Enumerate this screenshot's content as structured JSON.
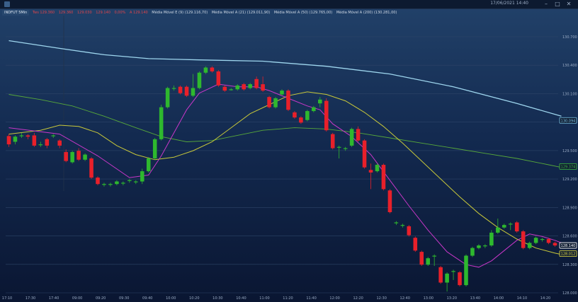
{
  "window": {
    "datetime": "17/06/2021 14:40",
    "buttons": [
      "–",
      "□",
      "✕"
    ]
  },
  "legend": {
    "symbol": "INDFUT 5Min",
    "quote": [
      {
        "text": "Tws 129.360"
      },
      {
        "text": "129.360"
      },
      {
        "text": "129.030"
      },
      {
        "text": "129.140"
      },
      {
        "text": "0,00%"
      },
      {
        "text": "A 129.140"
      }
    ],
    "indicators": [
      {
        "text": "Média Móvel E (9) (129.116,70)"
      },
      {
        "text": "Média Móvel A (21) (129.011,90)"
      },
      {
        "text": "Média Móvel A (50) (129.765,00)"
      },
      {
        "text": "Média Móvel A (200) (130.281,00)"
      }
    ]
  },
  "colors": {
    "up": "#2eb82e",
    "down": "#e8202a",
    "ema9": "#c837c8",
    "sma21": "#c8c83a",
    "sma50": "#57a83a",
    "sma200": "#9ed6ee",
    "grid": "#2c4468",
    "crosshair": "#22324a"
  },
  "chart_data": {
    "type": "candlestick",
    "y_axis_ticks": [
      "130.700",
      "130.400",
      "130.100",
      "129.800",
      "129.500",
      "129.200",
      "128.900",
      "128.600",
      "128.300",
      "128.000"
    ],
    "x_axis_ticks": [
      "17:10",
      "17:30",
      "17:40",
      "09:00",
      "09:20",
      "09:30",
      "09:40",
      "10:00",
      "10:20",
      "10:30",
      "10:40",
      "11:00",
      "11:20",
      "11:40",
      "12:00",
      "12:20",
      "12:30",
      "12:40",
      "13:00",
      "13:20",
      "13:40",
      "14:00",
      "14:10",
      "14:20"
    ],
    "price_tags": [
      {
        "label": "130.094",
        "value": 130.094,
        "color": "#7ec8e8"
      },
      {
        "label": "129.374",
        "value": 129.374,
        "color": "#3fbf3f"
      },
      {
        "label": "128.140",
        "value": 128.14,
        "color": "#ffffff"
      },
      {
        "label": "128.012",
        "value": 128.012,
        "color": "#e8e040"
      }
    ],
    "candles": [
      {
        "o": 129.85,
        "c": 129.72,
        "h": 129.88,
        "l": 129.68
      },
      {
        "o": 129.76,
        "c": 129.84,
        "h": 129.86,
        "l": 129.72
      },
      {
        "o": 129.86,
        "c": 129.86,
        "h": 129.9,
        "l": 129.82
      },
      {
        "o": 129.86,
        "c": 129.84,
        "h": 129.88,
        "l": 129.8
      },
      {
        "o": 129.86,
        "c": 129.7,
        "h": 129.9,
        "l": 129.68
      },
      {
        "o": 129.72,
        "c": 129.72,
        "h": 129.76,
        "l": 129.68
      },
      {
        "o": 129.8,
        "c": 129.7,
        "h": 129.82,
        "l": 129.66
      },
      {
        "o": 129.86,
        "c": 129.86,
        "h": 129.88,
        "l": 129.82
      },
      {
        "o": 129.78,
        "c": 129.7,
        "h": 129.8,
        "l": 129.66
      },
      {
        "o": 129.6,
        "c": 129.46,
        "h": 129.64,
        "l": 129.44
      },
      {
        "o": 129.44,
        "c": 129.6,
        "h": 129.62,
        "l": 129.42
      },
      {
        "o": 129.62,
        "c": 129.48,
        "h": 129.66,
        "l": 129.46
      },
      {
        "o": 129.48,
        "c": 129.56,
        "h": 129.58,
        "l": 129.46
      },
      {
        "o": 129.5,
        "c": 129.2,
        "h": 129.52,
        "l": 129.18
      },
      {
        "o": 129.2,
        "c": 129.1,
        "h": 129.22,
        "l": 129.08
      },
      {
        "o": 129.1,
        "c": 129.1,
        "h": 129.12,
        "l": 129.06
      },
      {
        "o": 129.1,
        "c": 129.1,
        "h": 129.12,
        "l": 129.06
      },
      {
        "o": 129.1,
        "c": 129.14,
        "h": 129.16,
        "l": 129.08
      },
      {
        "o": 129.12,
        "c": 129.12,
        "h": 129.14,
        "l": 129.08
      },
      {
        "o": 129.16,
        "c": 129.16,
        "h": 129.18,
        "l": 129.12
      },
      {
        "o": 129.14,
        "c": 129.14,
        "h": 129.16,
        "l": 129.1
      },
      {
        "o": 129.14,
        "c": 129.3,
        "h": 129.34,
        "l": 129.1
      },
      {
        "o": 129.3,
        "c": 129.5,
        "h": 129.52,
        "l": 129.28
      },
      {
        "o": 129.5,
        "c": 129.8,
        "h": 129.82,
        "l": 129.48
      },
      {
        "o": 129.8,
        "c": 130.3,
        "h": 130.34,
        "l": 129.78
      },
      {
        "o": 130.3,
        "c": 130.6,
        "h": 130.62,
        "l": 130.28
      },
      {
        "o": 130.6,
        "c": 130.6,
        "h": 130.64,
        "l": 130.56
      },
      {
        "o": 130.62,
        "c": 130.52,
        "h": 130.64,
        "l": 130.5
      },
      {
        "o": 130.62,
        "c": 130.48,
        "h": 130.64,
        "l": 130.46
      },
      {
        "o": 130.48,
        "c": 130.6,
        "h": 130.82,
        "l": 130.46
      },
      {
        "o": 130.6,
        "c": 130.84,
        "h": 130.86,
        "l": 130.58
      },
      {
        "o": 130.84,
        "c": 130.92,
        "h": 130.94,
        "l": 130.82
      },
      {
        "o": 130.92,
        "c": 130.86,
        "h": 130.94,
        "l": 130.84
      },
      {
        "o": 130.86,
        "c": 130.64,
        "h": 130.88,
        "l": 130.62
      },
      {
        "o": 130.62,
        "c": 130.56,
        "h": 130.64,
        "l": 130.54
      },
      {
        "o": 130.58,
        "c": 130.58,
        "h": 130.6,
        "l": 130.56
      },
      {
        "o": 130.58,
        "c": 130.64,
        "h": 130.66,
        "l": 130.56
      },
      {
        "o": 130.66,
        "c": 130.58,
        "h": 130.68,
        "l": 130.56
      },
      {
        "o": 130.6,
        "c": 130.66,
        "h": 130.68,
        "l": 130.58
      },
      {
        "o": 130.74,
        "c": 130.6,
        "h": 130.78,
        "l": 130.58
      },
      {
        "o": 130.66,
        "c": 130.56,
        "h": 130.78,
        "l": 130.54
      },
      {
        "o": 130.46,
        "c": 130.3,
        "h": 130.48,
        "l": 130.28
      },
      {
        "o": 130.3,
        "c": 130.44,
        "h": 130.46,
        "l": 130.28
      },
      {
        "o": 130.5,
        "c": 130.56,
        "h": 130.58,
        "l": 130.48
      },
      {
        "o": 130.56,
        "c": 130.26,
        "h": 130.58,
        "l": 130.24
      },
      {
        "o": 130.22,
        "c": 130.14,
        "h": 130.24,
        "l": 130.12
      },
      {
        "o": 130.14,
        "c": 130.06,
        "h": 130.16,
        "l": 130.04
      },
      {
        "o": 130.1,
        "c": 130.24,
        "h": 130.26,
        "l": 130.08
      },
      {
        "o": 130.24,
        "c": 130.3,
        "h": 130.32,
        "l": 130.22
      },
      {
        "o": 130.36,
        "c": 130.42,
        "h": 130.46,
        "l": 130.3
      },
      {
        "o": 130.4,
        "c": 129.94,
        "h": 130.44,
        "l": 129.92
      },
      {
        "o": 129.88,
        "c": 129.66,
        "h": 129.9,
        "l": 129.64
      },
      {
        "o": 129.68,
        "c": 129.68,
        "h": 129.7,
        "l": 129.5
      },
      {
        "o": 129.66,
        "c": 129.66,
        "h": 129.68,
        "l": 129.62
      },
      {
        "o": 129.7,
        "c": 129.96,
        "h": 129.98,
        "l": 129.68
      },
      {
        "o": 129.96,
        "c": 129.78,
        "h": 130.0,
        "l": 129.76
      },
      {
        "o": 129.78,
        "c": 129.36,
        "h": 129.8,
        "l": 129.34
      },
      {
        "o": 129.32,
        "c": 129.28,
        "h": 129.42,
        "l": 129.02
      },
      {
        "o": 129.3,
        "c": 129.4,
        "h": 129.42,
        "l": 129.28
      },
      {
        "o": 129.4,
        "c": 129.02,
        "h": 129.42,
        "l": 129.0
      },
      {
        "o": 129.0,
        "c": 128.66,
        "h": 129.02,
        "l": 128.64
      },
      {
        "o": 128.5,
        "c": 128.5,
        "h": 128.52,
        "l": 128.46
      },
      {
        "o": 128.46,
        "c": 128.46,
        "h": 128.48,
        "l": 128.42
      },
      {
        "o": 128.44,
        "c": 128.3,
        "h": 128.46,
        "l": 128.28
      },
      {
        "o": 128.26,
        "c": 128.06,
        "h": 128.28,
        "l": 128.04
      },
      {
        "o": 128.04,
        "c": 127.84,
        "h": 128.06,
        "l": 127.82
      },
      {
        "o": 127.84,
        "c": 127.94,
        "h": 127.96,
        "l": 127.82
      },
      {
        "o": 127.98,
        "c": 127.98,
        "h": 128.0,
        "l": 127.82
      },
      {
        "o": 127.8,
        "c": 127.56,
        "h": 127.82,
        "l": 127.54
      },
      {
        "o": 127.56,
        "c": 127.7,
        "h": 127.72,
        "l": 127.42
      },
      {
        "o": 127.74,
        "c": 127.74,
        "h": 127.76,
        "l": 127.6
      },
      {
        "o": 127.72,
        "c": 127.52,
        "h": 127.74,
        "l": 127.5
      },
      {
        "o": 127.52,
        "c": 127.98,
        "h": 128.0,
        "l": 127.5
      },
      {
        "o": 127.98,
        "c": 128.1,
        "h": 128.12,
        "l": 127.96
      },
      {
        "o": 128.1,
        "c": 128.14,
        "h": 128.16,
        "l": 128.08
      },
      {
        "o": 128.14,
        "c": 128.14,
        "h": 128.16,
        "l": 128.1
      },
      {
        "o": 128.14,
        "c": 128.34,
        "h": 128.38,
        "l": 128.12
      },
      {
        "o": 128.34,
        "c": 128.42,
        "h": 128.56,
        "l": 128.32
      },
      {
        "o": 128.42,
        "c": 128.46,
        "h": 128.48,
        "l": 128.4
      },
      {
        "o": 128.48,
        "c": 128.48,
        "h": 128.5,
        "l": 128.38
      },
      {
        "o": 128.5,
        "c": 128.36,
        "h": 128.52,
        "l": 128.34
      },
      {
        "o": 128.36,
        "c": 128.1,
        "h": 128.38,
        "l": 128.08
      },
      {
        "o": 128.1,
        "c": 128.18,
        "h": 128.2,
        "l": 128.08
      },
      {
        "o": 128.18,
        "c": 128.26,
        "h": 128.28,
        "l": 128.16
      },
      {
        "o": 128.24,
        "c": 128.24,
        "h": 128.26,
        "l": 128.2
      },
      {
        "o": 128.24,
        "c": 128.18,
        "h": 128.26,
        "l": 128.16
      },
      {
        "o": 128.18,
        "c": 128.14,
        "h": 128.2,
        "l": 128.12
      }
    ],
    "ema9": [
      [
        0,
        129.98
      ],
      [
        8,
        129.88
      ],
      [
        14,
        129.54
      ],
      [
        19,
        129.2
      ],
      [
        22,
        129.24
      ],
      [
        24,
        129.54
      ],
      [
        26,
        129.9
      ],
      [
        28,
        130.26
      ],
      [
        30,
        130.52
      ],
      [
        33,
        130.66
      ],
      [
        36,
        130.62
      ],
      [
        39,
        130.62
      ],
      [
        41,
        130.56
      ],
      [
        44,
        130.44
      ],
      [
        47,
        130.32
      ],
      [
        49,
        130.26
      ],
      [
        51,
        130.04
      ],
      [
        54,
        129.84
      ],
      [
        57,
        129.56
      ],
      [
        60,
        129.16
      ],
      [
        63,
        128.76
      ],
      [
        66,
        128.38
      ],
      [
        69,
        128.04
      ],
      [
        72,
        127.84
      ],
      [
        74,
        127.8
      ],
      [
        76,
        127.9
      ],
      [
        78,
        128.06
      ],
      [
        80,
        128.22
      ],
      [
        82,
        128.32
      ],
      [
        84,
        128.28
      ],
      [
        86,
        128.22
      ],
      [
        87,
        128.18
      ]
    ],
    "sma21": [
      [
        0,
        129.88
      ],
      [
        5,
        129.94
      ],
      [
        8,
        130.02
      ],
      [
        11,
        130.0
      ],
      [
        14,
        129.9
      ],
      [
        17,
        129.7
      ],
      [
        20,
        129.56
      ],
      [
        23,
        129.48
      ],
      [
        26,
        129.52
      ],
      [
        29,
        129.62
      ],
      [
        32,
        129.76
      ],
      [
        35,
        129.98
      ],
      [
        38,
        130.2
      ],
      [
        41,
        130.34
      ],
      [
        44,
        130.48
      ],
      [
        47,
        130.54
      ],
      [
        50,
        130.5
      ],
      [
        53,
        130.4
      ],
      [
        56,
        130.22
      ],
      [
        59,
        130.0
      ],
      [
        62,
        129.74
      ],
      [
        65,
        129.46
      ],
      [
        68,
        129.18
      ],
      [
        71,
        128.9
      ],
      [
        74,
        128.64
      ],
      [
        77,
        128.42
      ],
      [
        80,
        128.24
      ],
      [
        83,
        128.1
      ],
      [
        86,
        128.02
      ],
      [
        87,
        128.0
      ]
    ],
    "sma50": [
      [
        0,
        130.5
      ],
      [
        5,
        130.42
      ],
      [
        10,
        130.32
      ],
      [
        15,
        130.16
      ],
      [
        20,
        129.98
      ],
      [
        24,
        129.84
      ],
      [
        28,
        129.76
      ],
      [
        32,
        129.78
      ],
      [
        36,
        129.86
      ],
      [
        40,
        129.94
      ],
      [
        45,
        129.98
      ],
      [
        50,
        129.96
      ],
      [
        55,
        129.9
      ],
      [
        60,
        129.82
      ],
      [
        65,
        129.74
      ],
      [
        70,
        129.66
      ],
      [
        75,
        129.58
      ],
      [
        80,
        129.5
      ],
      [
        85,
        129.4
      ],
      [
        87,
        129.36
      ]
    ],
    "sma200": [
      [
        0,
        131.34
      ],
      [
        8,
        131.22
      ],
      [
        15,
        131.12
      ],
      [
        22,
        131.06
      ],
      [
        30,
        131.04
      ],
      [
        40,
        131.02
      ],
      [
        50,
        130.94
      ],
      [
        60,
        130.82
      ],
      [
        70,
        130.62
      ],
      [
        80,
        130.36
      ],
      [
        87,
        130.16
      ]
    ]
  }
}
